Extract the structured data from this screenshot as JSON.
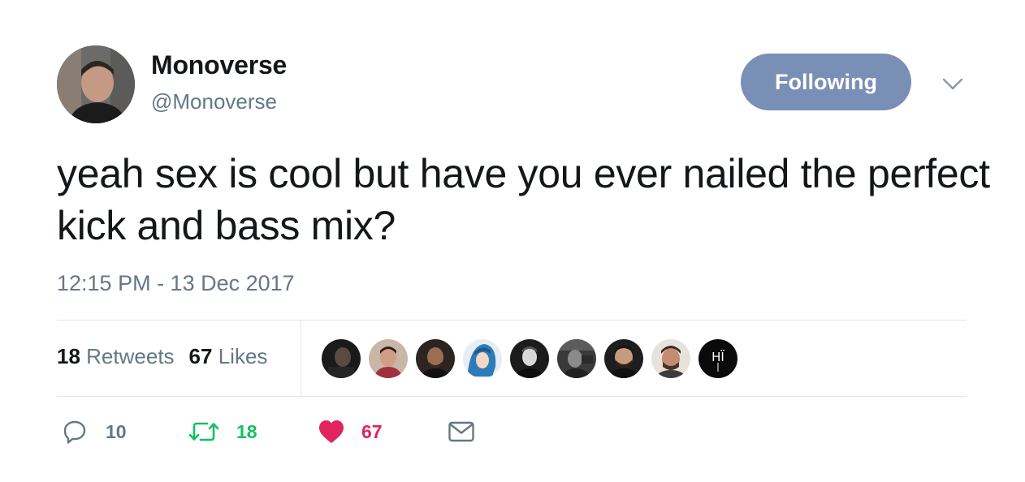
{
  "user": {
    "display_name": "Monoverse",
    "handle": "@Monoverse",
    "avatar_icon": "user-avatar"
  },
  "follow_button": {
    "label": "Following",
    "color": "#7a8fb5"
  },
  "tweet": {
    "text": "yeah sex is cool but have you ever nailed the perfect kick and bass mix?",
    "timestamp": "12:15 PM - 13 Dec 2017"
  },
  "stats": {
    "retweets_count": "18",
    "retweets_label": "Retweets",
    "likes_count": "67",
    "likes_label": "Likes"
  },
  "likers": [
    {
      "name": "liker-avatar-1"
    },
    {
      "name": "liker-avatar-2"
    },
    {
      "name": "liker-avatar-3"
    },
    {
      "name": "liker-avatar-4"
    },
    {
      "name": "liker-avatar-5"
    },
    {
      "name": "liker-avatar-6"
    },
    {
      "name": "liker-avatar-7"
    },
    {
      "name": "liker-avatar-8"
    },
    {
      "name": "liker-avatar-9",
      "text": "HÏ"
    }
  ],
  "actions": {
    "reply_count": "10",
    "retweet_count": "18",
    "like_count": "67",
    "reply_icon": "reply-icon",
    "retweet_icon": "retweet-icon",
    "like_icon": "heart-icon",
    "message_icon": "envelope-icon"
  },
  "colors": {
    "text_primary": "#14171a",
    "text_secondary": "#657786",
    "retweet_green": "#17bf63",
    "like_red": "#e0245e",
    "divider": "#e1e8ed"
  }
}
